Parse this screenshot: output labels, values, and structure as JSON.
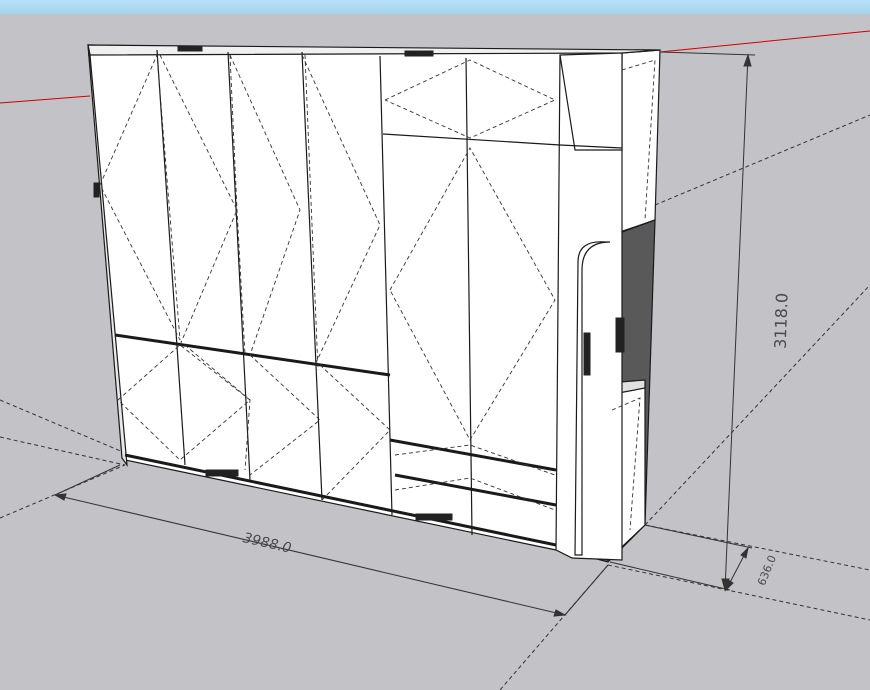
{
  "scene": {
    "dimensions": {
      "width_label": "3988.0",
      "height_label": "3118.0",
      "depth_label": "636.0"
    },
    "colors": {
      "sky": "#a9d6f2",
      "ground": "#c3c3c7",
      "red_axis": "#d00000",
      "panel": "#ffffff",
      "cutout": "#595959",
      "edge": "#1a1a1a"
    }
  }
}
